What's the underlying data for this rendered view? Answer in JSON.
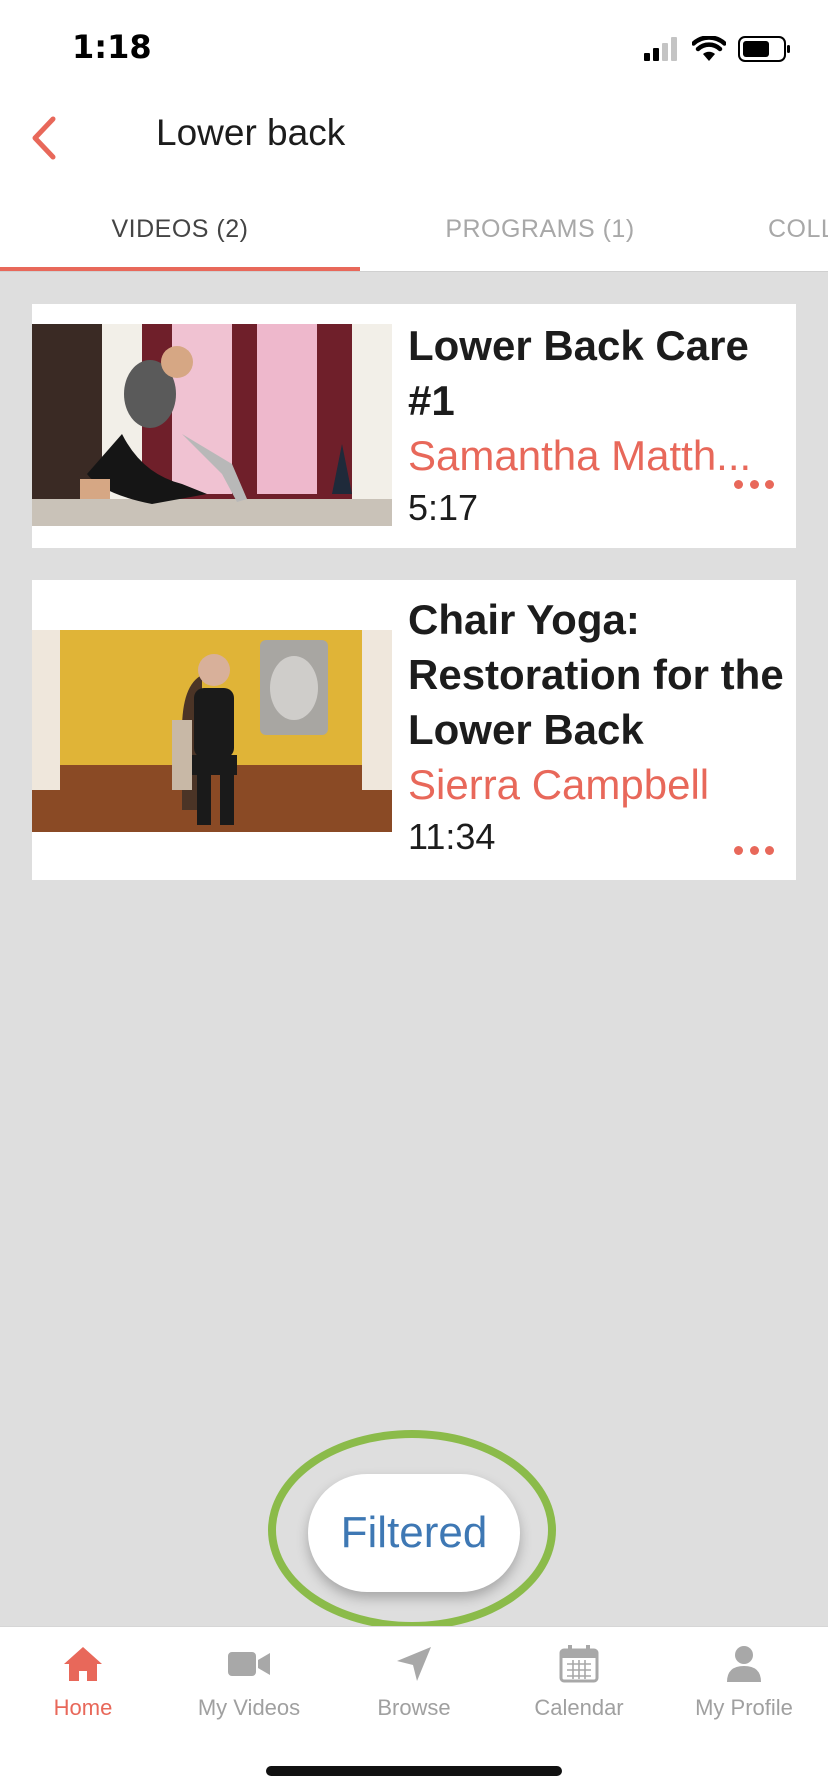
{
  "status_bar": {
    "time": "1:18"
  },
  "nav": {
    "title": "Lower back",
    "back_icon": "chevron-left-icon"
  },
  "tabs": [
    {
      "label": "VIDEOS (2)",
      "active": true
    },
    {
      "label": "PROGRAMS (1)",
      "active": false
    },
    {
      "label": "COLL",
      "active": false
    }
  ],
  "videos": [
    {
      "title": "Lower Back Care #1",
      "author": "Samantha Matth...",
      "duration": "5:17"
    },
    {
      "title": "Chair Yoga: Restoration for the Lower Back",
      "author": "Sierra Campbell",
      "duration": "11:34"
    }
  ],
  "filter_button": {
    "label": "Filtered"
  },
  "tab_bar": [
    {
      "label": "Home",
      "icon": "home-icon",
      "active": true
    },
    {
      "label": "My Videos",
      "icon": "video-camera-icon",
      "active": false
    },
    {
      "label": "Browse",
      "icon": "navigation-arrow-icon",
      "active": false
    },
    {
      "label": "Calendar",
      "icon": "calendar-icon",
      "active": false
    },
    {
      "label": "My Profile",
      "icon": "person-icon",
      "active": false
    }
  ],
  "colors": {
    "accent": "#e8685a",
    "link_blue": "#3e78b4",
    "highlight_ring": "#8bbb4a",
    "background": "#dedede"
  }
}
